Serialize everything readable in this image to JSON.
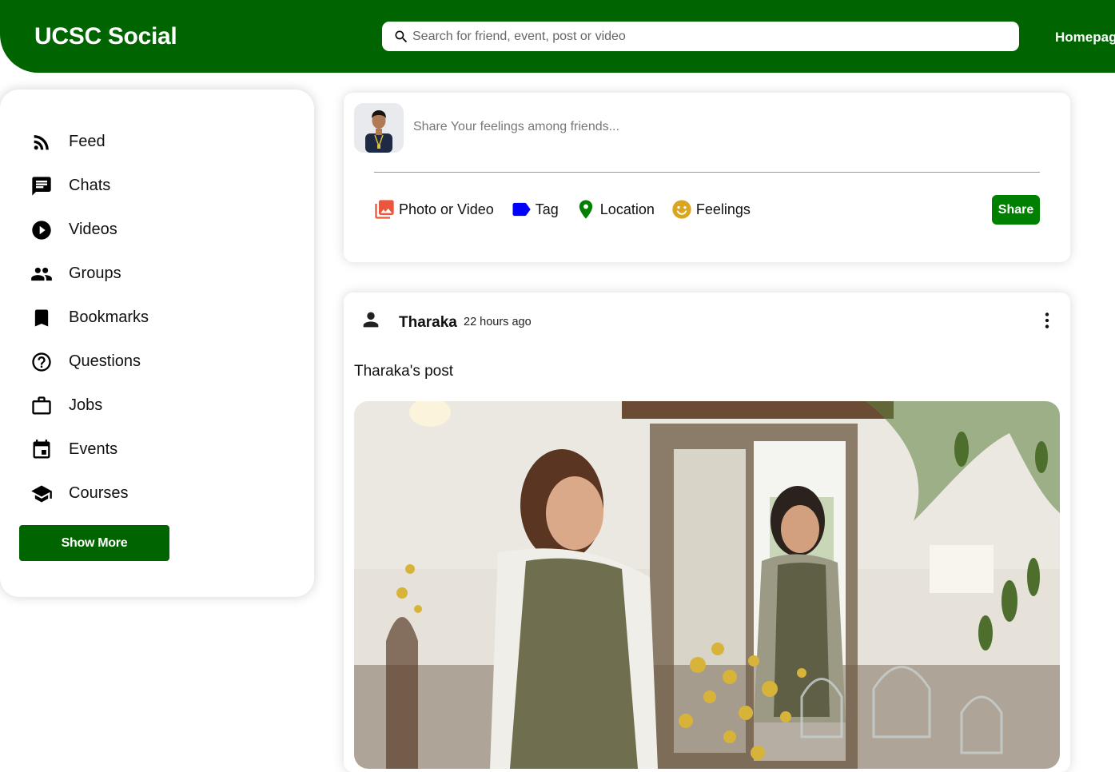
{
  "header": {
    "logo": "UCSC Social",
    "search_placeholder": "Search for friend, event, post or video",
    "nav_link": "Homepage"
  },
  "sidebar": {
    "items": [
      {
        "label": "Feed",
        "icon": "rss-feed-icon"
      },
      {
        "label": "Chats",
        "icon": "chat-icon"
      },
      {
        "label": "Videos",
        "icon": "play-circle-icon"
      },
      {
        "label": "Groups",
        "icon": "group-icon"
      },
      {
        "label": "Bookmarks",
        "icon": "bookmark-icon"
      },
      {
        "label": "Questions",
        "icon": "help-circle-icon"
      },
      {
        "label": "Jobs",
        "icon": "work-outline-icon"
      },
      {
        "label": "Events",
        "icon": "event-icon"
      },
      {
        "label": "Courses",
        "icon": "school-icon"
      }
    ],
    "show_more_label": "Show More"
  },
  "composer": {
    "placeholder": "Share Your feelings among friends...",
    "options": [
      {
        "label": "Photo or Video",
        "icon": "photo-icon",
        "color": "#e9573f"
      },
      {
        "label": "Tag",
        "icon": "label-icon",
        "color": "#0000ff"
      },
      {
        "label": "Location",
        "icon": "location-pin-icon",
        "color": "#008000"
      },
      {
        "label": "Feelings",
        "icon": "emoji-icon",
        "color": "#daa520"
      }
    ],
    "share_label": "Share"
  },
  "post": {
    "author": "Tharaka",
    "time": "22 hours ago",
    "text": "Tharaka's post"
  },
  "colors": {
    "brand_green": "#006400",
    "share_green": "#008000"
  }
}
